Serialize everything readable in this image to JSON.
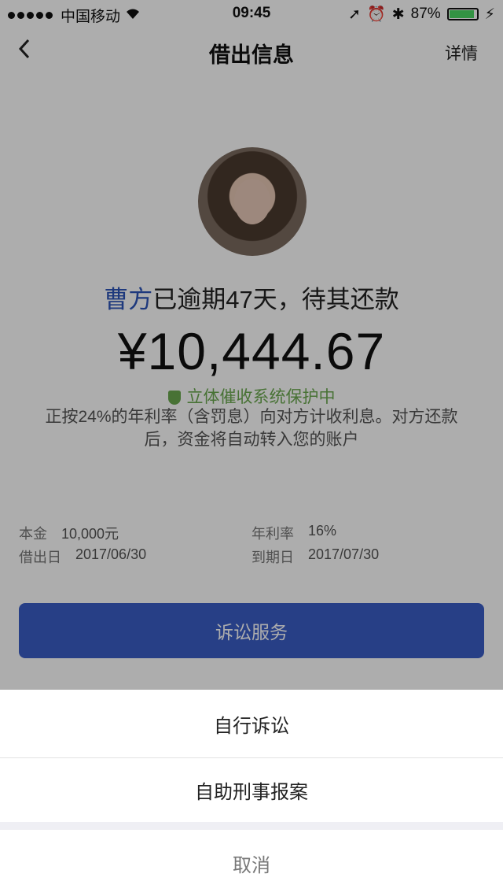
{
  "status_bar": {
    "carrier": "中国移动",
    "time": "09:45",
    "battery": "87%"
  },
  "nav": {
    "title": "借出信息",
    "detail": "详情"
  },
  "borrower": {
    "name": "曹方",
    "status_text": "已逾期47天，待其还款"
  },
  "amount": "¥10,444.67",
  "protection": "立体催收系统保护中",
  "description": "正按24%的年利率（含罚息）向对方计收利息。对方还款后，资金将自动转入您的账户",
  "info": {
    "principal_label": "本金",
    "principal_value": "10,000元",
    "rate_label": "年利率",
    "rate_value": "16%",
    "lend_date_label": "借出日",
    "lend_date_value": "2017/06/30",
    "due_date_label": "到期日",
    "due_date_value": "2017/07/30"
  },
  "lawsuit_button": "诉讼服务",
  "action_sheet": {
    "option1": "自行诉讼",
    "option2": "自助刑事报案",
    "cancel": "取消"
  },
  "colors": {
    "accent": "#3a5ec6",
    "name": "#2d55b8",
    "protect": "#6aa84f"
  },
  "icons": [
    "wifi-icon",
    "location-icon",
    "alarm-icon",
    "bluetooth-icon",
    "back-icon",
    "shield-icon"
  ]
}
